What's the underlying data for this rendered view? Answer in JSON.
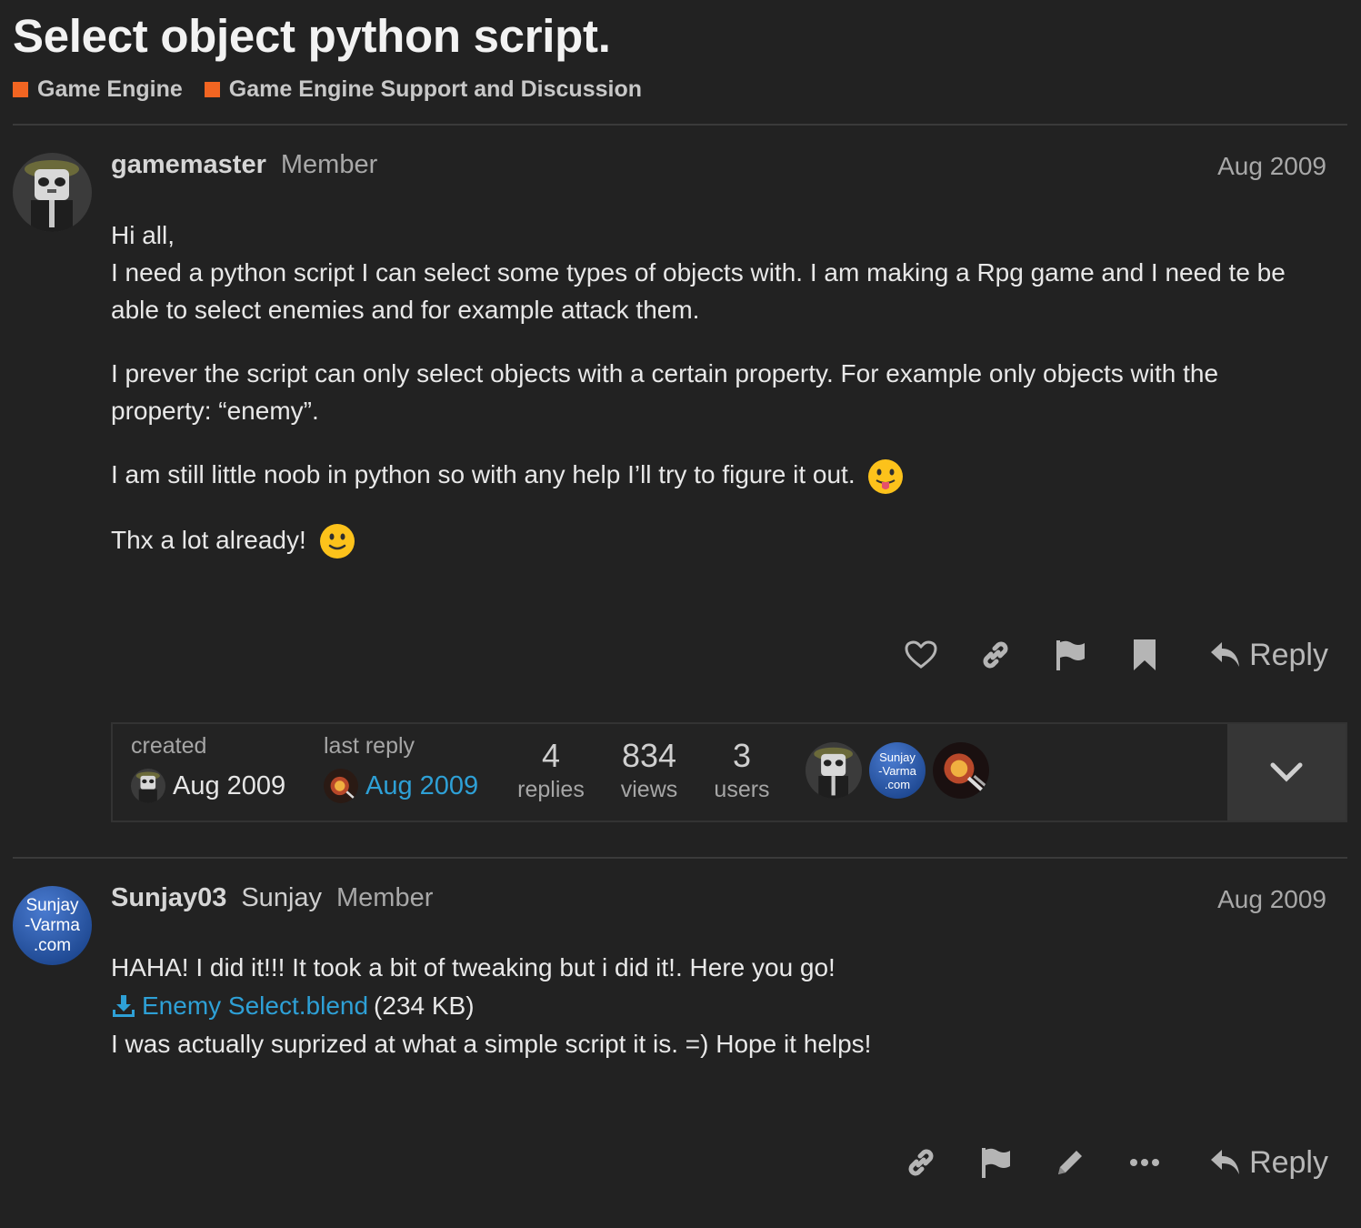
{
  "topic": {
    "title": "Select object python script.",
    "categories": [
      {
        "label": "Game Engine",
        "color": "#f26522"
      },
      {
        "label": "Game Engine Support and Discussion",
        "color": "#f26522"
      }
    ]
  },
  "post1": {
    "username": "gamemaster",
    "user_title": "Member",
    "date": "Aug 2009",
    "paragraphs": {
      "p1_line1": "Hi all,",
      "p1_line2": "I need a python script I can select some types of objects with. I am making a Rpg game and I need te be able to select enemies and for example attack them.",
      "p2": "I prever the script can only select objects with a certain property. For example only objects with the property: “enemy”.",
      "p3": "I am still little noob in python so with any help I’ll try to figure it out.",
      "p4": "Thx a lot already!"
    },
    "emojis": [
      "stuck-out-tongue-icon",
      "slight-smile-icon"
    ],
    "reply_label": "Reply"
  },
  "topic_map": {
    "created_label": "created",
    "created_date": "Aug 2009",
    "last_reply_label": "last reply",
    "last_reply_date": "Aug 2009",
    "replies_count": "4",
    "replies_label": "replies",
    "views_count": "834",
    "views_label": "views",
    "users_count": "3",
    "users_label": "users",
    "avatar_text": "Sunjay\n-Varma\n.com"
  },
  "post2": {
    "username": "Sunjay03",
    "full_name": "Sunjay",
    "user_title": "Member",
    "date": "Aug 2009",
    "avatar_lines": [
      "Sunjay",
      "-Varma",
      ".com"
    ],
    "line1": "HAHA! I did it!!! It took a bit of tweaking but i did it!. Here you go!",
    "attachment_name": "Enemy Select.blend",
    "attachment_size": "(234 KB)",
    "line3": "I was actually suprized at what a simple script it is. =) Hope it helps!",
    "reply_label": "Reply"
  },
  "colors": {
    "background": "#222222",
    "category": "#f26522",
    "link": "#2ea0d6"
  }
}
